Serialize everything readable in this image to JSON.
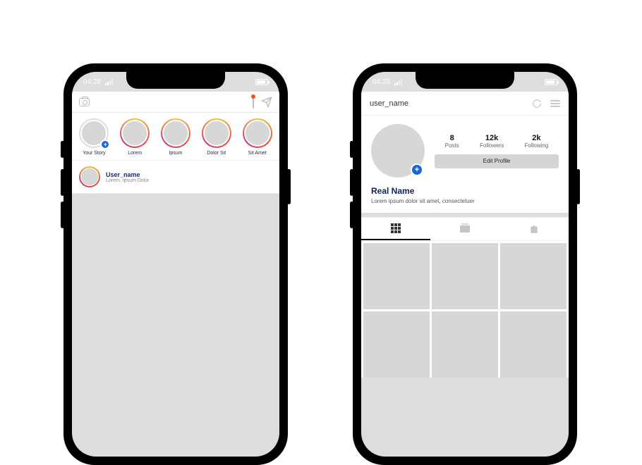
{
  "status": {
    "time": "04:28"
  },
  "feed": {
    "stories": [
      {
        "label": "Your Story",
        "own": true
      },
      {
        "label": "Lorem"
      },
      {
        "label": "Ipsum"
      },
      {
        "label": "Dolor Sit"
      },
      {
        "label": "Sit Amet"
      }
    ],
    "post": {
      "user": "User_name",
      "sub": "Lorem, Ipsum Dolor"
    }
  },
  "profile": {
    "username": "user_name",
    "stats": {
      "posts": {
        "n": "8",
        "l": "Posts"
      },
      "followers": {
        "n": "12k",
        "l": "Followers"
      },
      "following": {
        "n": "2k",
        "l": "Following"
      }
    },
    "edit_label": "Edit Profile",
    "real_name": "Real Name",
    "bio": "Lorem ipsum dolor sit amet, consectetuer"
  }
}
